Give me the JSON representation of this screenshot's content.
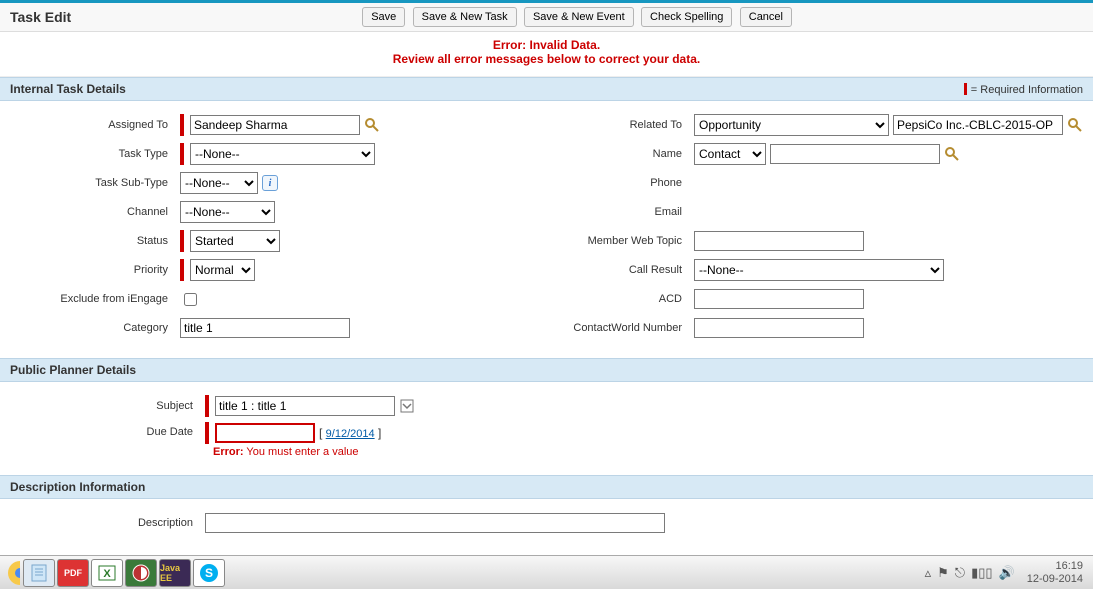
{
  "header": {
    "title": "Task Edit",
    "buttons": {
      "save": "Save",
      "saveNewTask": "Save & New Task",
      "saveNewEvent": "Save & New Event",
      "checkSpelling": "Check Spelling",
      "cancel": "Cancel"
    }
  },
  "errorBanner": {
    "line1": "Error: Invalid Data.",
    "line2": "Review all error messages below to correct your data."
  },
  "sections": {
    "internal": {
      "title": "Internal Task Details",
      "requiredInfo": "= Required Information"
    },
    "planner": {
      "title": "Public Planner Details"
    },
    "description": {
      "title": "Description Information"
    }
  },
  "labels": {
    "assignedTo": "Assigned To",
    "taskType": "Task Type",
    "taskSubType": "Task Sub-Type",
    "channel": "Channel",
    "status": "Status",
    "priority": "Priority",
    "excludeIengage": "Exclude from iEngage",
    "category": "Category",
    "relatedTo": "Related To",
    "name": "Name",
    "phone": "Phone",
    "email": "Email",
    "memberWebTopic": "Member Web Topic",
    "callResult": "Call Result",
    "acd": "ACD",
    "contactWorld": "ContactWorld Number",
    "subject": "Subject",
    "dueDate": "Due Date",
    "description": "Description"
  },
  "values": {
    "assignedTo": "Sandeep Sharma",
    "taskType": "--None--",
    "taskSubType": "--None--",
    "channel": "--None--",
    "status": "Started",
    "priority": "Normal",
    "category": "title 1",
    "relatedToType": "Opportunity",
    "relatedToValue": "PepsiCo Inc.-CBLC-2015-OP",
    "nameType": "Contact",
    "nameValue": "",
    "memberWebTopic": "",
    "callResult": "--None--",
    "acd": "",
    "contactWorld": "",
    "subject": "title 1 : title 1",
    "dueDate": "",
    "dueDateQuick": "9/12/2014",
    "description": ""
  },
  "errors": {
    "dueDate": {
      "label": "Error:",
      "msg": "You must enter a value"
    }
  },
  "taskbar": {
    "pdf": "PDF",
    "java": "Java EE",
    "skype": "S",
    "time": "16:19",
    "date": "12-09-2014"
  }
}
